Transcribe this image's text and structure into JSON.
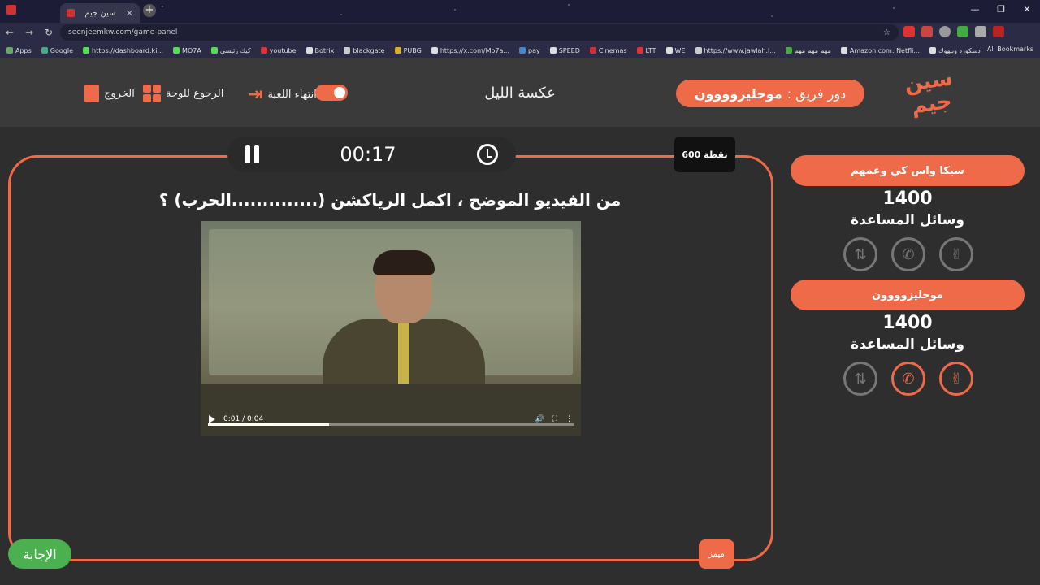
{
  "browser": {
    "tab_title": "سين جيم",
    "url": "seenjeemkw.com/game-panel",
    "bookmarks": [
      "Apps",
      "Google",
      "https://dashboard.ki...",
      "MO7A",
      "كيك رئيسي",
      "youtube",
      "Botrix",
      "blackgate",
      "PUBG",
      "https://x.com/Mo7a...",
      "pay",
      "SPEED",
      "Cinemas",
      "LTT",
      "WE",
      "https://www.jawlah.l...",
      "مهم مهم مهم",
      "Amazon.com: Netfli...",
      "دسكورد وبيهوك"
    ],
    "all_bookmarks": "All Bookmarks"
  },
  "header": {
    "logo": "سين جيم",
    "turn_prefix": "دور فريق :",
    "turn_team": "موحليزوووون",
    "game_title": "عكسة الليل",
    "end_game": "انتهاء اللعبة",
    "back_to_board": "الرجوع للوحة",
    "exit": "الخروج"
  },
  "question_panel": {
    "timer": "00:17",
    "points": "600 نقطة",
    "question": "من الفيديو الموضح ، اكمل الرياكشن (..............الحرب) ؟",
    "video_time": "0:01 / 0:04",
    "video_progress": 0.33,
    "answer_label": "الإجابة",
    "memes_label": "ميمز"
  },
  "teams": [
    {
      "name": "سيكا واس كي وعمهم",
      "score": "1400",
      "aids_label": "وسائل المساعدة"
    },
    {
      "name": "موحليزوووون",
      "score": "1400",
      "aids_label": "وسائل المساعدة"
    }
  ],
  "colors": {
    "accent": "#ef6a48",
    "answer": "#4caf50",
    "bg": "#2e2e2e"
  }
}
